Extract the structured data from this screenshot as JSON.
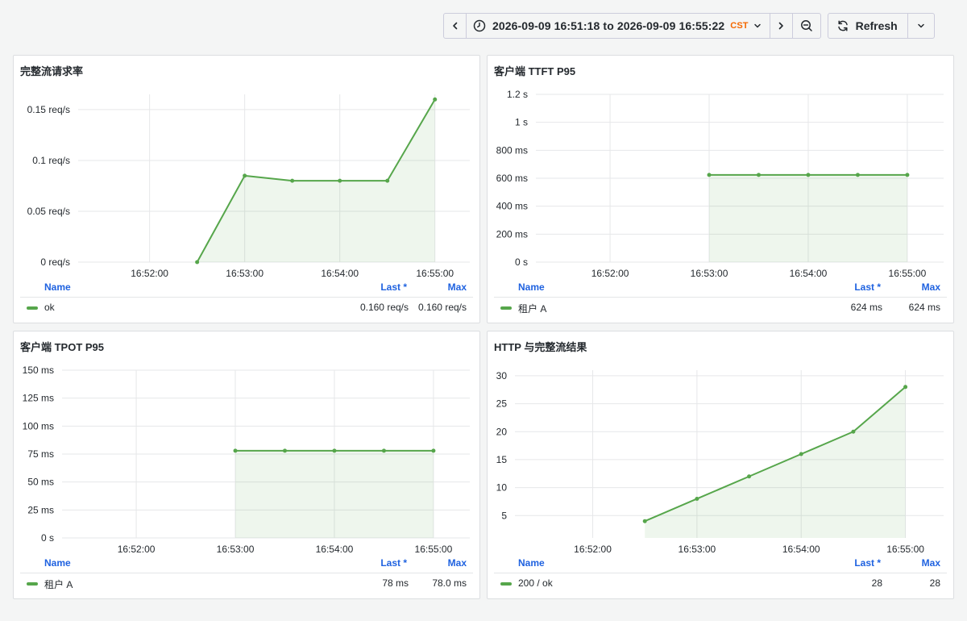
{
  "toolbar": {
    "time_range": "2026-09-09 16:51:18 to 2026-09-09 16:55:22",
    "timezone": "CST",
    "refresh_label": "Refresh"
  },
  "colors": {
    "series": "#56a64b",
    "legend_header": "#1f62e0",
    "timezone": "#f46800"
  },
  "legend_labels": {
    "name": "Name",
    "last": "Last *",
    "max": "Max"
  },
  "panels": [
    {
      "title": "完整流请求率",
      "legend": {
        "name": "ok",
        "last": "0.160 req/s",
        "max": "0.160 req/s"
      }
    },
    {
      "title": "客户端 TTFT P95",
      "legend": {
        "name": "租户 A",
        "last": "624 ms",
        "max": "624 ms"
      }
    },
    {
      "title": "客户端 TPOT P95",
      "legend": {
        "name": "租户 A",
        "last": "78 ms",
        "max": "78.0 ms"
      }
    },
    {
      "title": "HTTP 与完整流结果",
      "legend": {
        "name": "200 / ok",
        "last": "28",
        "max": "28"
      }
    }
  ],
  "chart_data": [
    {
      "type": "line",
      "title": "完整流请求率",
      "x_ticks": [
        "16:52:00",
        "16:53:00",
        "16:54:00",
        "16:55:00"
      ],
      "x_range": [
        "16:51:18",
        "16:55:22"
      ],
      "y_ticks": [
        "0 req/s",
        "0.05 req/s",
        "0.1 req/s",
        "0.15 req/s"
      ],
      "ylim": [
        0,
        0.165
      ],
      "y_tick_values": [
        0,
        0.05,
        0.1,
        0.15
      ],
      "series": [
        {
          "name": "ok",
          "x": [
            "16:52:30",
            "16:53:00",
            "16:53:30",
            "16:54:00",
            "16:54:30",
            "16:55:00"
          ],
          "values": [
            0,
            0.085,
            0.08,
            0.08,
            0.08,
            0.16
          ]
        }
      ],
      "fill": true,
      "grid": true,
      "legend_placement": "bottom"
    },
    {
      "type": "line",
      "title": "客户端 TTFT P95",
      "x_ticks": [
        "16:52:00",
        "16:53:00",
        "16:54:00",
        "16:55:00"
      ],
      "x_range": [
        "16:51:18",
        "16:55:22"
      ],
      "y_ticks": [
        "0 s",
        "200 ms",
        "400 ms",
        "600 ms",
        "800 ms",
        "1 s",
        "1.2 s"
      ],
      "ylim": [
        0,
        1.2
      ],
      "y_tick_values": [
        0,
        0.2,
        0.4,
        0.6,
        0.8,
        1.0,
        1.2
      ],
      "series": [
        {
          "name": "租户 A",
          "x": [
            "16:53:00",
            "16:53:30",
            "16:54:00",
            "16:54:30",
            "16:55:00"
          ],
          "values": [
            0.624,
            0.624,
            0.624,
            0.624,
            0.624
          ]
        }
      ],
      "fill": true,
      "grid": true,
      "legend_placement": "bottom"
    },
    {
      "type": "line",
      "title": "客户端 TPOT P95",
      "x_ticks": [
        "16:52:00",
        "16:53:00",
        "16:54:00",
        "16:55:00"
      ],
      "x_range": [
        "16:51:18",
        "16:55:22"
      ],
      "y_ticks": [
        "0 s",
        "25 ms",
        "50 ms",
        "75 ms",
        "100 ms",
        "125 ms",
        "150 ms"
      ],
      "ylim": [
        0,
        150
      ],
      "y_tick_values": [
        0,
        25,
        50,
        75,
        100,
        125,
        150
      ],
      "series": [
        {
          "name": "租户 A",
          "x": [
            "16:53:00",
            "16:53:30",
            "16:54:00",
            "16:54:30",
            "16:55:00"
          ],
          "values": [
            78,
            78,
            78,
            78,
            78
          ]
        }
      ],
      "fill": true,
      "grid": true,
      "legend_placement": "bottom"
    },
    {
      "type": "line",
      "title": "HTTP 与完整流结果",
      "x_ticks": [
        "16:52:00",
        "16:53:00",
        "16:54:00",
        "16:55:00"
      ],
      "x_range": [
        "16:51:18",
        "16:55:22"
      ],
      "y_ticks": [
        "5",
        "10",
        "15",
        "20",
        "25",
        "30"
      ],
      "ylim": [
        1,
        31
      ],
      "y_tick_values": [
        5,
        10,
        15,
        20,
        25,
        30
      ],
      "series": [
        {
          "name": "200 / ok",
          "x": [
            "16:52:30",
            "16:53:00",
            "16:53:30",
            "16:54:00",
            "16:54:30",
            "16:55:00"
          ],
          "values": [
            4,
            8,
            12,
            16,
            20,
            28
          ]
        }
      ],
      "fill": true,
      "grid": true,
      "legend_placement": "bottom"
    }
  ]
}
